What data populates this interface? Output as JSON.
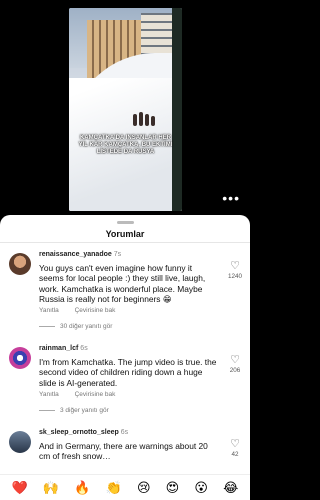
{
  "video": {
    "caption": "Kamçatka'da insanlar her yıl kar KAMÇATKA, BU EKTİMİ LİSTEDE DA RUSYA",
    "menu_icon": "more-horizontal-icon"
  },
  "sheet": {
    "title": "Yorumlar"
  },
  "comments": [
    {
      "username": "renaissance_yanadoe",
      "time": "7s",
      "text": "You guys can't even imagine how funny it seems for local people :) they still live, laugh, work. Kamchatka is wonderful place. Maybe Russia is really not for beginners 😁",
      "reply_label": "Yanıtla",
      "translate_label": "Çevirisine bak",
      "likes": "1240",
      "more_replies": "30 diğer yanıtı gör"
    },
    {
      "username": "rainman_lcf",
      "time": "6s",
      "text": "I'm from Kamchatka. The jump video is true. the second video of children riding down a huge slide is AI-generated.",
      "reply_label": "Yanıtla",
      "translate_label": "Çevirisine bak",
      "likes": "206",
      "more_replies": "3 diğer yanıtı gör"
    },
    {
      "username": "sk_sleep_ornotto_sleep",
      "time": "6s",
      "text": "And in Germany, there are warnings about 20 cm of fresh snow…",
      "likes": "42"
    }
  ],
  "emojis": [
    "❤️",
    "🙌",
    "🔥",
    "👏",
    "😢",
    "😍",
    "😮",
    "😂"
  ]
}
